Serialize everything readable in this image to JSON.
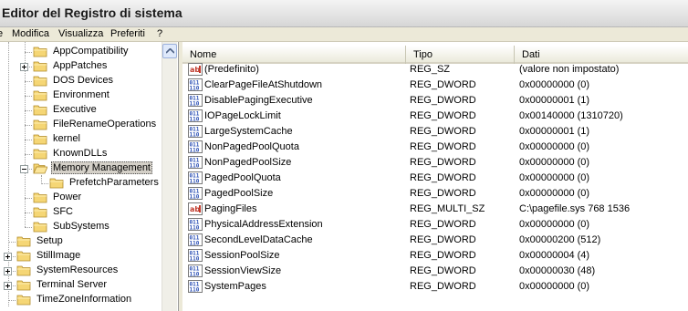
{
  "window": {
    "title": "Editor del Registro di sistema"
  },
  "menu": [
    "Modifica",
    "Visualizza",
    "Preferiti",
    "?"
  ],
  "tree": [
    {
      "label": "AppCompatibility",
      "expander": false
    },
    {
      "label": "AppPatches",
      "expander": true
    },
    {
      "label": "DOS Devices",
      "expander": false
    },
    {
      "label": "Environment",
      "expander": false
    },
    {
      "label": "Executive",
      "expander": false
    },
    {
      "label": "FileRenameOperations",
      "expander": false
    },
    {
      "label": "kernel",
      "expander": false
    },
    {
      "label": "KnownDLLs",
      "expander": false
    },
    {
      "label": "Memory Management",
      "expander": true,
      "expanded": true,
      "selected": true
    },
    {
      "label": "PrefetchParameters",
      "expander": false
    },
    {
      "label": "Power",
      "expander": false
    },
    {
      "label": "SFC",
      "expander": false
    },
    {
      "label": "SubSystems",
      "expander": false
    },
    {
      "label": "Setup",
      "expander": false
    },
    {
      "label": "StillImage",
      "expander": true
    },
    {
      "label": "SystemResources",
      "expander": true
    },
    {
      "label": "Terminal Server",
      "expander": true
    },
    {
      "label": "TimeZoneInformation",
      "expander": false
    }
  ],
  "columns": {
    "name": "Nome",
    "type": "Tipo",
    "data": "Dati"
  },
  "values": [
    {
      "icon": "string-value-icon",
      "name": "(Predefinito)",
      "type": "REG_SZ",
      "data": "(valore non impostato)"
    },
    {
      "icon": "binary-value-icon",
      "name": "ClearPageFileAtShutdown",
      "type": "REG_DWORD",
      "data": "0x00000000 (0)"
    },
    {
      "icon": "binary-value-icon",
      "name": "DisablePagingExecutive",
      "type": "REG_DWORD",
      "data": "0x00000001 (1)"
    },
    {
      "icon": "binary-value-icon",
      "name": "IOPageLockLimit",
      "type": "REG_DWORD",
      "data": "0x00140000 (1310720)"
    },
    {
      "icon": "binary-value-icon",
      "name": "LargeSystemCache",
      "type": "REG_DWORD",
      "data": "0x00000001 (1)"
    },
    {
      "icon": "binary-value-icon",
      "name": "NonPagedPoolQuota",
      "type": "REG_DWORD",
      "data": "0x00000000 (0)"
    },
    {
      "icon": "binary-value-icon",
      "name": "NonPagedPoolSize",
      "type": "REG_DWORD",
      "data": "0x00000000 (0)"
    },
    {
      "icon": "binary-value-icon",
      "name": "PagedPoolQuota",
      "type": "REG_DWORD",
      "data": "0x00000000 (0)"
    },
    {
      "icon": "binary-value-icon",
      "name": "PagedPoolSize",
      "type": "REG_DWORD",
      "data": "0x00000000 (0)"
    },
    {
      "icon": "string-value-icon",
      "name": "PagingFiles",
      "type": "REG_MULTI_SZ",
      "data": "C:\\pagefile.sys 768 1536"
    },
    {
      "icon": "binary-value-icon",
      "name": "PhysicalAddressExtension",
      "type": "REG_DWORD",
      "data": "0x00000000 (0)"
    },
    {
      "icon": "binary-value-icon",
      "name": "SecondLevelDataCache",
      "type": "REG_DWORD",
      "data": "0x00000200 (512)"
    },
    {
      "icon": "binary-value-icon",
      "name": "SessionPoolSize",
      "type": "REG_DWORD",
      "data": "0x00000004 (4)"
    },
    {
      "icon": "binary-value-icon",
      "name": "SessionViewSize",
      "type": "REG_DWORD",
      "data": "0x00000030 (48)"
    },
    {
      "icon": "binary-value-icon",
      "name": "SystemPages",
      "type": "REG_DWORD",
      "data": "0x00000000 (0)"
    }
  ],
  "colors": {
    "folder": "#f5d675",
    "folder_edge": "#b08a2a",
    "string_icon": "#c0392b",
    "binary_icon": "#2a4fb5"
  }
}
